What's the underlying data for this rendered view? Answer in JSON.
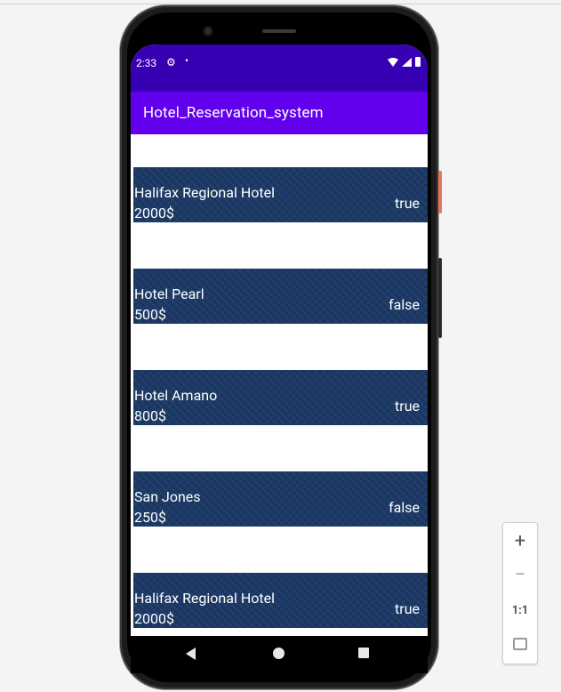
{
  "status_bar": {
    "time": "2:33"
  },
  "app_bar": {
    "title": "Hotel_Reservation_system"
  },
  "hotels": [
    {
      "name": "Halifax Regional Hotel",
      "price": "2000$",
      "available": "true"
    },
    {
      "name": "Hotel Pearl",
      "price": "500$",
      "available": "false"
    },
    {
      "name": "Hotel Amano",
      "price": "800$",
      "available": "true"
    },
    {
      "name": "San Jones",
      "price": "250$",
      "available": "false"
    },
    {
      "name": "Halifax Regional Hotel",
      "price": "2000$",
      "available": "true"
    }
  ],
  "zoom_controls": {
    "zoom_in": "+",
    "zoom_out": "−",
    "actual_size": "1:1"
  },
  "colors": {
    "status_bar": "#3700b3",
    "app_bar": "#6200ee",
    "row_background": "#1c3966",
    "row_text": "#ffffff"
  }
}
